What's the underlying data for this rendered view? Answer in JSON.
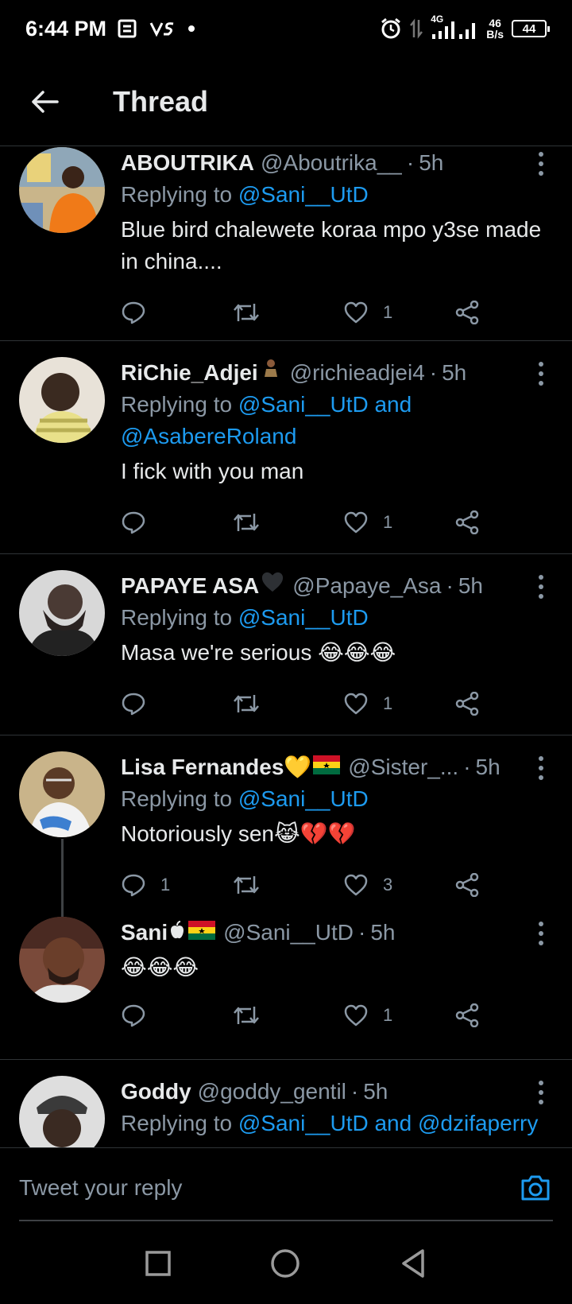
{
  "status_bar": {
    "time": "6:44 PM",
    "network": "4G",
    "speed_value": "46",
    "speed_unit": "B/s",
    "battery": "44"
  },
  "header": {
    "title": "Thread"
  },
  "tweets": [
    {
      "name": "ABOUTRIKA",
      "handle": "@Aboutrika__",
      "time": "5h",
      "reply_prefix": "Replying to",
      "reply_to": "@Sani__UtD",
      "reply_to2": "",
      "text": "Blue bird chalewete koraa mpo y3se made in china....",
      "replies": "",
      "likes": "1"
    },
    {
      "name": "RiChie_Adjei",
      "handle": "@richieadjei4",
      "time": "5h",
      "reply_prefix": "Replying to",
      "reply_to": "@Sani__UtD and",
      "reply_to2": "@AsabereRoland",
      "text": "I fick with you man",
      "replies": "",
      "likes": "1"
    },
    {
      "name": "PAPAYE ASA",
      "handle": "@Papaye_Asa",
      "time": "5h",
      "reply_prefix": "Replying to",
      "reply_to": "@Sani__UtD",
      "reply_to2": "",
      "text": "Masa we're serious 😂😂😂",
      "replies": "",
      "likes": "1"
    },
    {
      "name": "Lisa Fernandes💛",
      "handle": "@Sister_...",
      "time": "5h",
      "reply_prefix": "Replying to",
      "reply_to": "@Sani__UtD",
      "reply_to2": "",
      "text": "Notoriously sen😹💔💔",
      "replies": "1",
      "likes": "3"
    },
    {
      "name": "Sani",
      "handle": "@Sani__UtD",
      "time": "5h",
      "text": "😂😂😂",
      "replies": "",
      "likes": "1"
    },
    {
      "name": "Goddy",
      "handle": "@goddy_gentil",
      "time": "5h",
      "reply_prefix": "Replying to",
      "reply_to": "@Sani__UtD and @dzifaperry"
    }
  ],
  "compose": {
    "placeholder": "Tweet your reply"
  },
  "colors": {
    "accent": "#1d9bf0",
    "muted": "#8b98a5",
    "background": "#000000"
  }
}
